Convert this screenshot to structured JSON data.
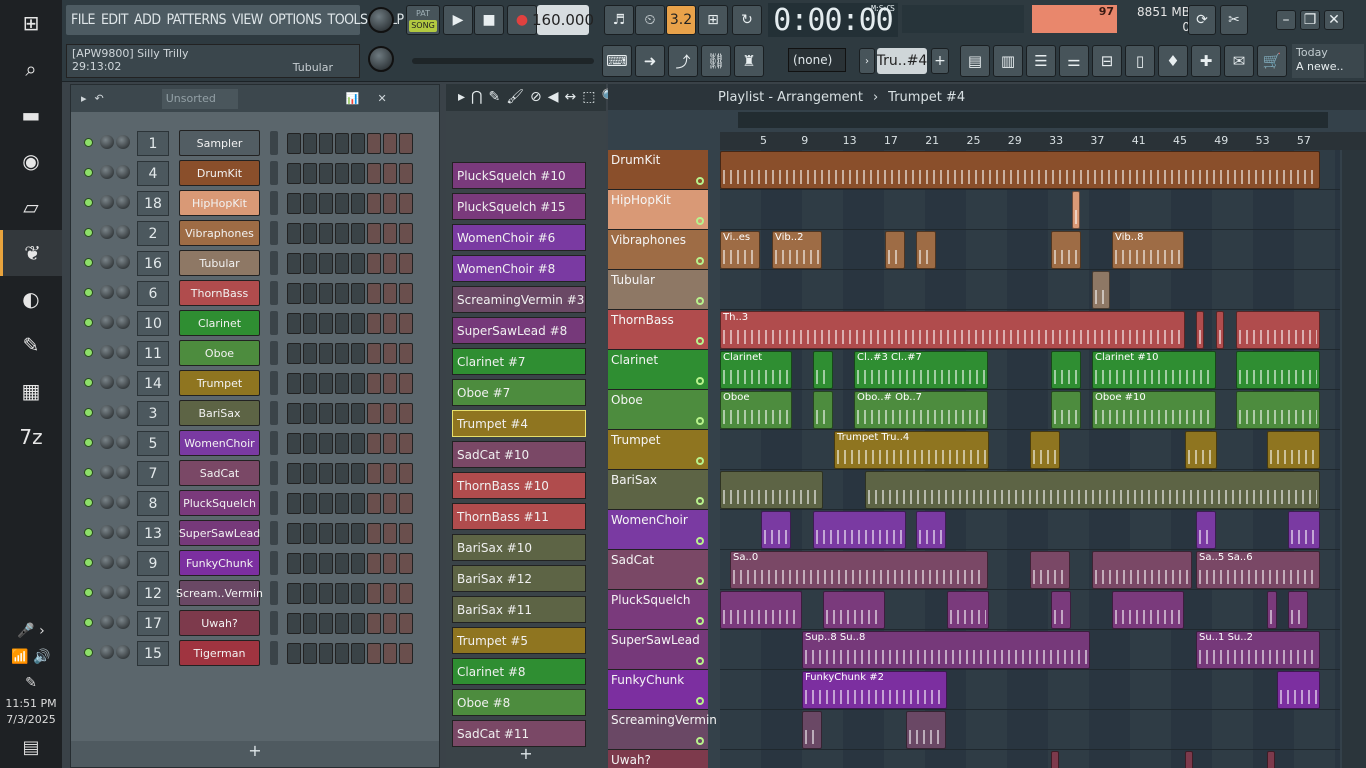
{
  "menu": [
    "FILE",
    "EDIT",
    "ADD",
    "PATTERNS",
    "VIEW",
    "OPTIONS",
    "TOOLS",
    "HELP"
  ],
  "hint": {
    "project": "[APW9800] Silly Trilly",
    "time": "29:13:02",
    "channel": "Tubular"
  },
  "transport": {
    "pat": "PAT",
    "song": "SONG",
    "tempo": "160.000",
    "time": "0:00:00",
    "time_label": "M:S:CS"
  },
  "cpu": {
    "value": "97",
    "memory": "8851 MB",
    "voices": "0"
  },
  "toolbar": {
    "pattern_select": "(none)",
    "pattern_name": "Tru..#4",
    "news_date": "Today",
    "news_text": "A newe.."
  },
  "taskbar": {
    "time": "11:51 PM",
    "date": "7/3/2025"
  },
  "rack": {
    "sort": "Unsorted",
    "add": "+",
    "channels": [
      {
        "num": "1",
        "name": "Sampler",
        "color": "#525d63"
      },
      {
        "num": "4",
        "name": "DrumKit",
        "color": "#8a4f2b"
      },
      {
        "num": "18",
        "name": "HipHopKit",
        "color": "#d99976"
      },
      {
        "num": "2",
        "name": "Vibraphones",
        "color": "#9e6c45"
      },
      {
        "num": "16",
        "name": "Tubular",
        "color": "#8e7865"
      },
      {
        "num": "6",
        "name": "ThornBass",
        "color": "#b04c4d"
      },
      {
        "num": "10",
        "name": "Clarinet",
        "color": "#2f8e32"
      },
      {
        "num": "11",
        "name": "Oboe",
        "color": "#4d8c3e"
      },
      {
        "num": "14",
        "name": "Trumpet",
        "color": "#8f7520"
      },
      {
        "num": "3",
        "name": "BariSax",
        "color": "#5d6445"
      },
      {
        "num": "5",
        "name": "WomenChoir",
        "color": "#7a3aa2"
      },
      {
        "num": "7",
        "name": "SadCat",
        "color": "#7a4866"
      },
      {
        "num": "8",
        "name": "PluckSquelch",
        "color": "#7a3a7c"
      },
      {
        "num": "13",
        "name": "SuperSawLead",
        "color": "#76397a"
      },
      {
        "num": "9",
        "name": "FunkyChunk",
        "color": "#7c2fa0"
      },
      {
        "num": "12",
        "name": "Scream..Vermin",
        "color": "#6a4865"
      },
      {
        "num": "17",
        "name": "Uwah?",
        "color": "#7d3a4c"
      },
      {
        "num": "15",
        "name": "Tigerman",
        "color": "#a03440"
      }
    ]
  },
  "picker": {
    "add": "+",
    "items": [
      {
        "name": "PluckSquelch #10",
        "color": "#7a3a7c"
      },
      {
        "name": "PluckSquelch #15",
        "color": "#7a3a7c"
      },
      {
        "name": "WomenChoir #6",
        "color": "#7a3aa2"
      },
      {
        "name": "WomenChoir #8",
        "color": "#7a3aa2"
      },
      {
        "name": "ScreamingVermin #3",
        "color": "#6a4865"
      },
      {
        "name": "SuperSawLead #8",
        "color": "#76397a"
      },
      {
        "name": "Clarinet #7",
        "color": "#2f8e32"
      },
      {
        "name": "Oboe #7",
        "color": "#4d8c3e"
      },
      {
        "name": "Trumpet #4",
        "color": "#8f7520"
      },
      {
        "name": "SadCat #10",
        "color": "#7a4866"
      },
      {
        "name": "ThornBass #10",
        "color": "#b04c4d"
      },
      {
        "name": "ThornBass #11",
        "color": "#b04c4d"
      },
      {
        "name": "BariSax #10",
        "color": "#5d6445"
      },
      {
        "name": "BariSax #12",
        "color": "#5d6445"
      },
      {
        "name": "BariSax #11",
        "color": "#5d6445"
      },
      {
        "name": "Trumpet #5",
        "color": "#8f7520"
      },
      {
        "name": "Clarinet #8",
        "color": "#2f8e32"
      },
      {
        "name": "Oboe #8",
        "color": "#4d8c3e"
      },
      {
        "name": "SadCat #11",
        "color": "#7a4866"
      }
    ]
  },
  "playlist": {
    "title": "Playlist - Arrangement",
    "crumb": "Trumpet #4",
    "ruler": [
      "5",
      "9",
      "13",
      "17",
      "21",
      "25",
      "29",
      "33",
      "37",
      "41",
      "45",
      "49",
      "53",
      "57"
    ],
    "tracks": [
      {
        "name": "DrumKit",
        "color": "#8a4f2b",
        "clips": [
          {
            "s": 0,
            "w": 600,
            "l": ""
          }
        ]
      },
      {
        "name": "HipHopKit",
        "color": "#d99976",
        "clips": [
          {
            "s": 352,
            "w": 8,
            "l": ""
          }
        ]
      },
      {
        "name": "Vibraphones",
        "color": "#9e6c45",
        "clips": [
          {
            "s": 0,
            "w": 40,
            "l": "Vi..es"
          },
          {
            "s": 52,
            "w": 50,
            "l": "Vib..2"
          },
          {
            "s": 165,
            "w": 20,
            "l": ""
          },
          {
            "s": 196,
            "w": 20,
            "l": ""
          },
          {
            "s": 331,
            "w": 30,
            "l": ""
          },
          {
            "s": 392,
            "w": 72,
            "l": "Vib..8"
          }
        ]
      },
      {
        "name": "Tubular",
        "color": "#8e7865",
        "clips": [
          {
            "s": 372,
            "w": 18,
            "l": ""
          }
        ]
      },
      {
        "name": "ThornBass",
        "color": "#b04c4d",
        "clips": [
          {
            "s": 0,
            "w": 465,
            "l": "Th..3"
          },
          {
            "s": 476,
            "w": 8,
            "l": ""
          },
          {
            "s": 496,
            "w": 8,
            "l": ""
          },
          {
            "s": 516,
            "w": 84,
            "l": ""
          }
        ]
      },
      {
        "name": "Clarinet",
        "color": "#2f8e32",
        "clips": [
          {
            "s": 0,
            "w": 72,
            "l": "Clarinet"
          },
          {
            "s": 93,
            "w": 20,
            "l": ""
          },
          {
            "s": 134,
            "w": 134,
            "l": "Cl..#3  Cl..#7"
          },
          {
            "s": 331,
            "w": 30,
            "l": ""
          },
          {
            "s": 372,
            "w": 124,
            "l": "Clarinet #10"
          },
          {
            "s": 516,
            "w": 84,
            "l": ""
          }
        ]
      },
      {
        "name": "Oboe",
        "color": "#4d8c3e",
        "clips": [
          {
            "s": 0,
            "w": 72,
            "l": "Oboe"
          },
          {
            "s": 93,
            "w": 20,
            "l": ""
          },
          {
            "s": 134,
            "w": 134,
            "l": "Obo..#  Ob..7"
          },
          {
            "s": 331,
            "w": 30,
            "l": ""
          },
          {
            "s": 372,
            "w": 124,
            "l": "Oboe #10"
          },
          {
            "s": 516,
            "w": 84,
            "l": ""
          }
        ]
      },
      {
        "name": "Trumpet",
        "color": "#8f7520",
        "clips": [
          {
            "s": 114,
            "w": 155,
            "l": "Trumpet   Tru..4"
          },
          {
            "s": 310,
            "w": 30,
            "l": ""
          },
          {
            "s": 465,
            "w": 32,
            "l": ""
          },
          {
            "s": 547,
            "w": 53,
            "l": ""
          }
        ]
      },
      {
        "name": "BariSax",
        "color": "#5d6445",
        "clips": [
          {
            "s": 0,
            "w": 103,
            "l": ""
          },
          {
            "s": 145,
            "w": 455,
            "l": ""
          }
        ]
      },
      {
        "name": "WomenChoir",
        "color": "#7a3aa2",
        "clips": [
          {
            "s": 41,
            "w": 30,
            "l": ""
          },
          {
            "s": 93,
            "w": 93,
            "l": ""
          },
          {
            "s": 196,
            "w": 30,
            "l": ""
          },
          {
            "s": 476,
            "w": 20,
            "l": ""
          },
          {
            "s": 568,
            "w": 32,
            "l": ""
          }
        ]
      },
      {
        "name": "SadCat",
        "color": "#7a4866",
        "clips": [
          {
            "s": 10,
            "w": 258,
            "l": "Sa..0"
          },
          {
            "s": 310,
            "w": 40,
            "l": ""
          },
          {
            "s": 372,
            "w": 100,
            "l": ""
          },
          {
            "s": 476,
            "w": 124,
            "l": "Sa..5  Sa..6"
          }
        ]
      },
      {
        "name": "PluckSquelch",
        "color": "#7a3a7c",
        "clips": [
          {
            "s": 0,
            "w": 82,
            "l": ""
          },
          {
            "s": 103,
            "w": 62,
            "l": ""
          },
          {
            "s": 227,
            "w": 42,
            "l": ""
          },
          {
            "s": 331,
            "w": 20,
            "l": ""
          },
          {
            "s": 392,
            "w": 72,
            "l": ""
          },
          {
            "s": 547,
            "w": 10,
            "l": ""
          },
          {
            "s": 568,
            "w": 20,
            "l": ""
          }
        ]
      },
      {
        "name": "SuperSawLead",
        "color": "#76397a",
        "clips": [
          {
            "s": 82,
            "w": 288,
            "l": "Sup..8  Su..8"
          },
          {
            "s": 476,
            "w": 124,
            "l": "Su..1  Su..2"
          }
        ]
      },
      {
        "name": "FunkyChunk",
        "color": "#7c2fa0",
        "clips": [
          {
            "s": 82,
            "w": 145,
            "l": "FunkyChunk #2"
          },
          {
            "s": 557,
            "w": 43,
            "l": ""
          }
        ]
      },
      {
        "name": "ScreamingVermin",
        "color": "#6a4865",
        "clips": [
          {
            "s": 82,
            "w": 20,
            "l": ""
          },
          {
            "s": 186,
            "w": 40,
            "l": ""
          }
        ]
      },
      {
        "name": "Uwah?",
        "color": "#7d3a4c",
        "clips": [
          {
            "s": 331,
            "w": 8,
            "l": ""
          },
          {
            "s": 465,
            "w": 8,
            "l": ""
          },
          {
            "s": 547,
            "w": 8,
            "l": ""
          }
        ]
      }
    ]
  }
}
